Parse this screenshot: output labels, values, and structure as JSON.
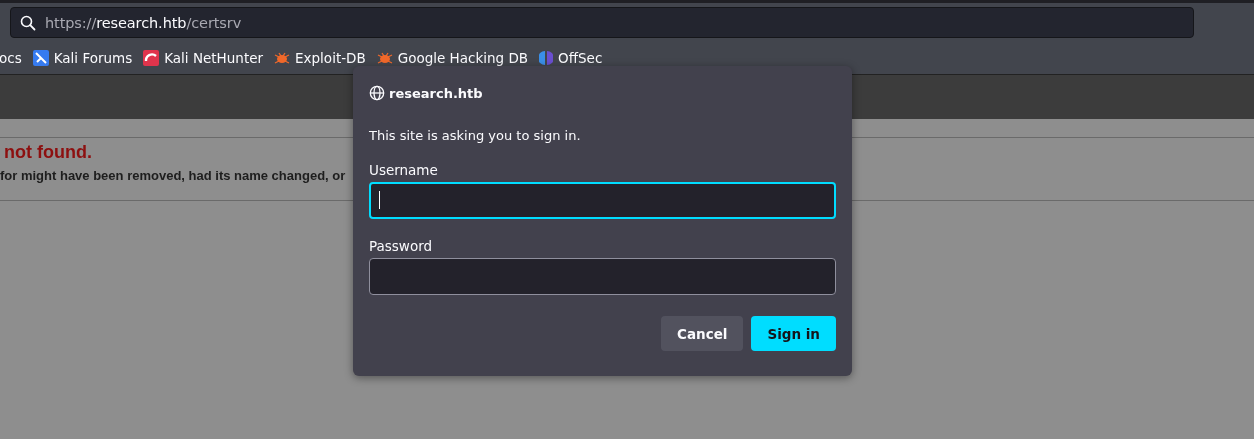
{
  "address_bar": {
    "prefix": "https://",
    "host": "research.htb",
    "path": "/certsrv"
  },
  "bookmarks": [
    {
      "label": "ocs",
      "kind": "plain"
    },
    {
      "label": "Kali Forums",
      "kind": "forum"
    },
    {
      "label": "Kali NetHunter",
      "kind": "mobile"
    },
    {
      "label": "Exploit-DB",
      "kind": "bug"
    },
    {
      "label": "Google Hacking DB",
      "kind": "bug"
    },
    {
      "label": "OffSec",
      "kind": "shield"
    }
  ],
  "page": {
    "heading": "not found.",
    "message": "for might have been removed, had its name changed, or"
  },
  "dialog": {
    "site": "research.htb",
    "prompt": "This site is asking you to sign in.",
    "fields": [
      {
        "label": "Username",
        "focused": true
      },
      {
        "label": "Password",
        "focused": false
      }
    ],
    "buttons": [
      {
        "label": "Cancel",
        "kind": "secondary"
      },
      {
        "label": "Sign in",
        "kind": "primary"
      }
    ]
  }
}
